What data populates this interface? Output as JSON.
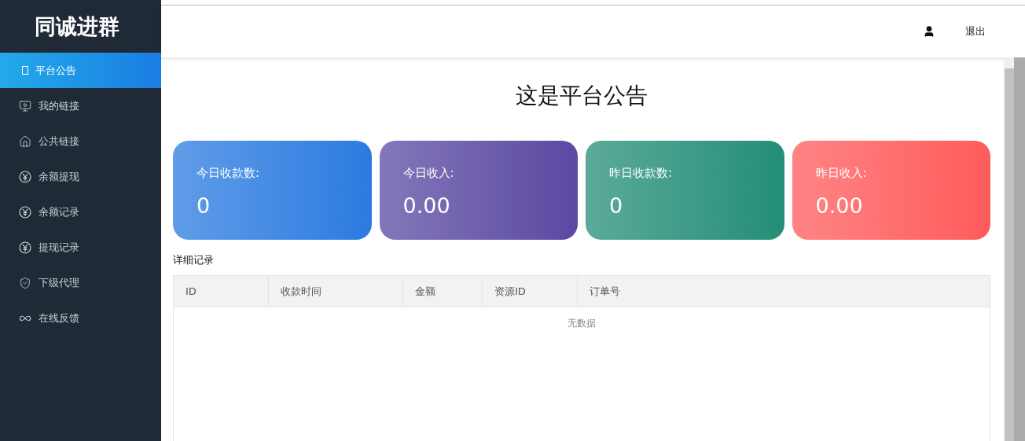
{
  "logo": "同诚进群",
  "sidebar": {
    "items": [
      {
        "label": "平台公告",
        "kind": "box",
        "selected": true
      },
      {
        "label": "我的链接",
        "kind": "screen",
        "selected": false
      },
      {
        "label": "公共链接",
        "kind": "house",
        "selected": false
      },
      {
        "label": "余额提现",
        "kind": "yen",
        "selected": false
      },
      {
        "label": "余额记录",
        "kind": "yen",
        "selected": false
      },
      {
        "label": "提现记录",
        "kind": "yen",
        "selected": false
      },
      {
        "label": "下级代理",
        "kind": "shield",
        "selected": false
      },
      {
        "label": "在线反馈",
        "kind": "loop",
        "selected": false
      }
    ]
  },
  "header": {
    "logout": "退出"
  },
  "notice_title": "这是平台公告",
  "stats": [
    {
      "label": "今日收款数:",
      "value": "0",
      "color": "#2b7be0"
    },
    {
      "label": "今日收入:",
      "value": "0.00",
      "color": "#5b49a2"
    },
    {
      "label": "昨日收款数:",
      "value": "0",
      "color": "#248e77"
    },
    {
      "label": "昨日收入:",
      "value": "0.00",
      "color": "#ff5b5b"
    }
  ],
  "table": {
    "title": "详细记录",
    "columns": [
      "ID",
      "收款时间",
      "金额",
      "资源ID",
      "订单号"
    ],
    "empty": "无数据"
  }
}
